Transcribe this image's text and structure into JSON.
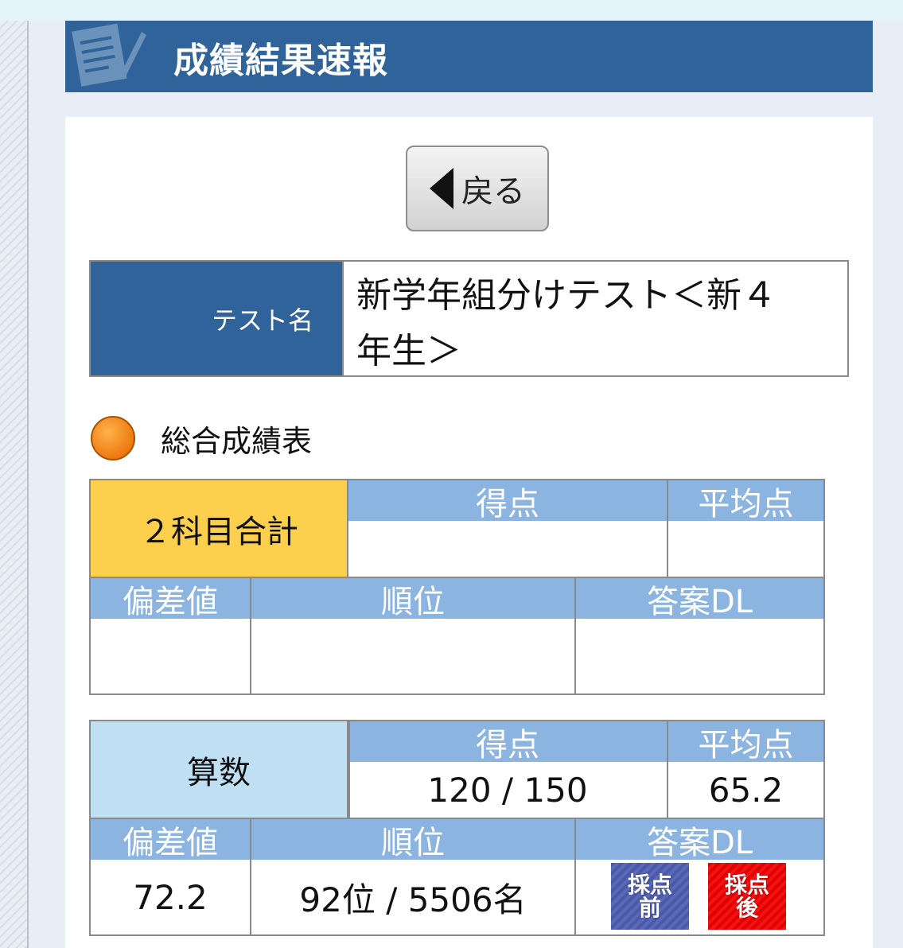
{
  "header": {
    "title": "成績結果速報",
    "icon": "notepad-pencil-icon"
  },
  "back_button": {
    "label": "戻る",
    "icon": "left-triangle-icon"
  },
  "test_name": {
    "label": "テスト名",
    "value_line1": "新学年組分けテスト＜新４",
    "value_line2": "年生＞"
  },
  "section": {
    "title": "総合成績表"
  },
  "tables": [
    {
      "subject": "２科目合計",
      "subject_color": "#fcd04c",
      "headers": {
        "score": "得点",
        "average": "平均点",
        "deviation": "偏差値",
        "rank": "順位",
        "answer_dl": "答案DL"
      },
      "values": {
        "score": "",
        "average": "",
        "deviation": "",
        "rank": ""
      }
    },
    {
      "subject": "算数",
      "subject_color": "#bfe0f2",
      "headers": {
        "score": "得点",
        "average": "平均点",
        "deviation": "偏差値",
        "rank": "順位",
        "answer_dl": "答案DL"
      },
      "values": {
        "score": "120 / 150",
        "average": "65.2",
        "deviation": "72.2",
        "rank": "92位 / 5506名"
      },
      "buttons": {
        "pre": [
          "採点",
          "前"
        ],
        "post": [
          "採点",
          "後"
        ]
      }
    }
  ],
  "colors": {
    "header_blue": "#2f6399",
    "table_header_blue": "#8bb4e0",
    "dl_pre": "#4a5aa8",
    "dl_post": "#e40000"
  }
}
